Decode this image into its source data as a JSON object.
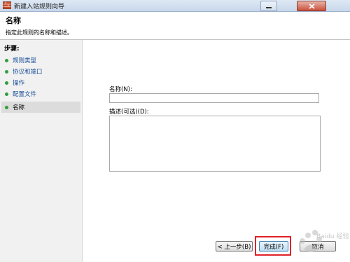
{
  "window": {
    "title": "新建入站规则向导"
  },
  "header": {
    "title": "名称",
    "description": "指定此规则的名称和描述。"
  },
  "sidebar": {
    "steps_label": "步骤:",
    "items": [
      {
        "label": "规则类型",
        "current": false
      },
      {
        "label": "协议和端口",
        "current": false
      },
      {
        "label": "操作",
        "current": false
      },
      {
        "label": "配置文件",
        "current": false
      },
      {
        "label": "名称",
        "current": true
      }
    ]
  },
  "form": {
    "name_label": "名称(N):",
    "name_value": "",
    "description_label": "描述(可选)(D):",
    "description_value": ""
  },
  "buttons": {
    "back": "< 上一步(B)",
    "finish": "完成(F)",
    "cancel": "取消"
  },
  "watermark": {
    "text": "Baidu 经验"
  },
  "colors": {
    "bullet": "#2e9e3a",
    "step_link": "#1c4f9a",
    "highlight": "#e0222a"
  }
}
